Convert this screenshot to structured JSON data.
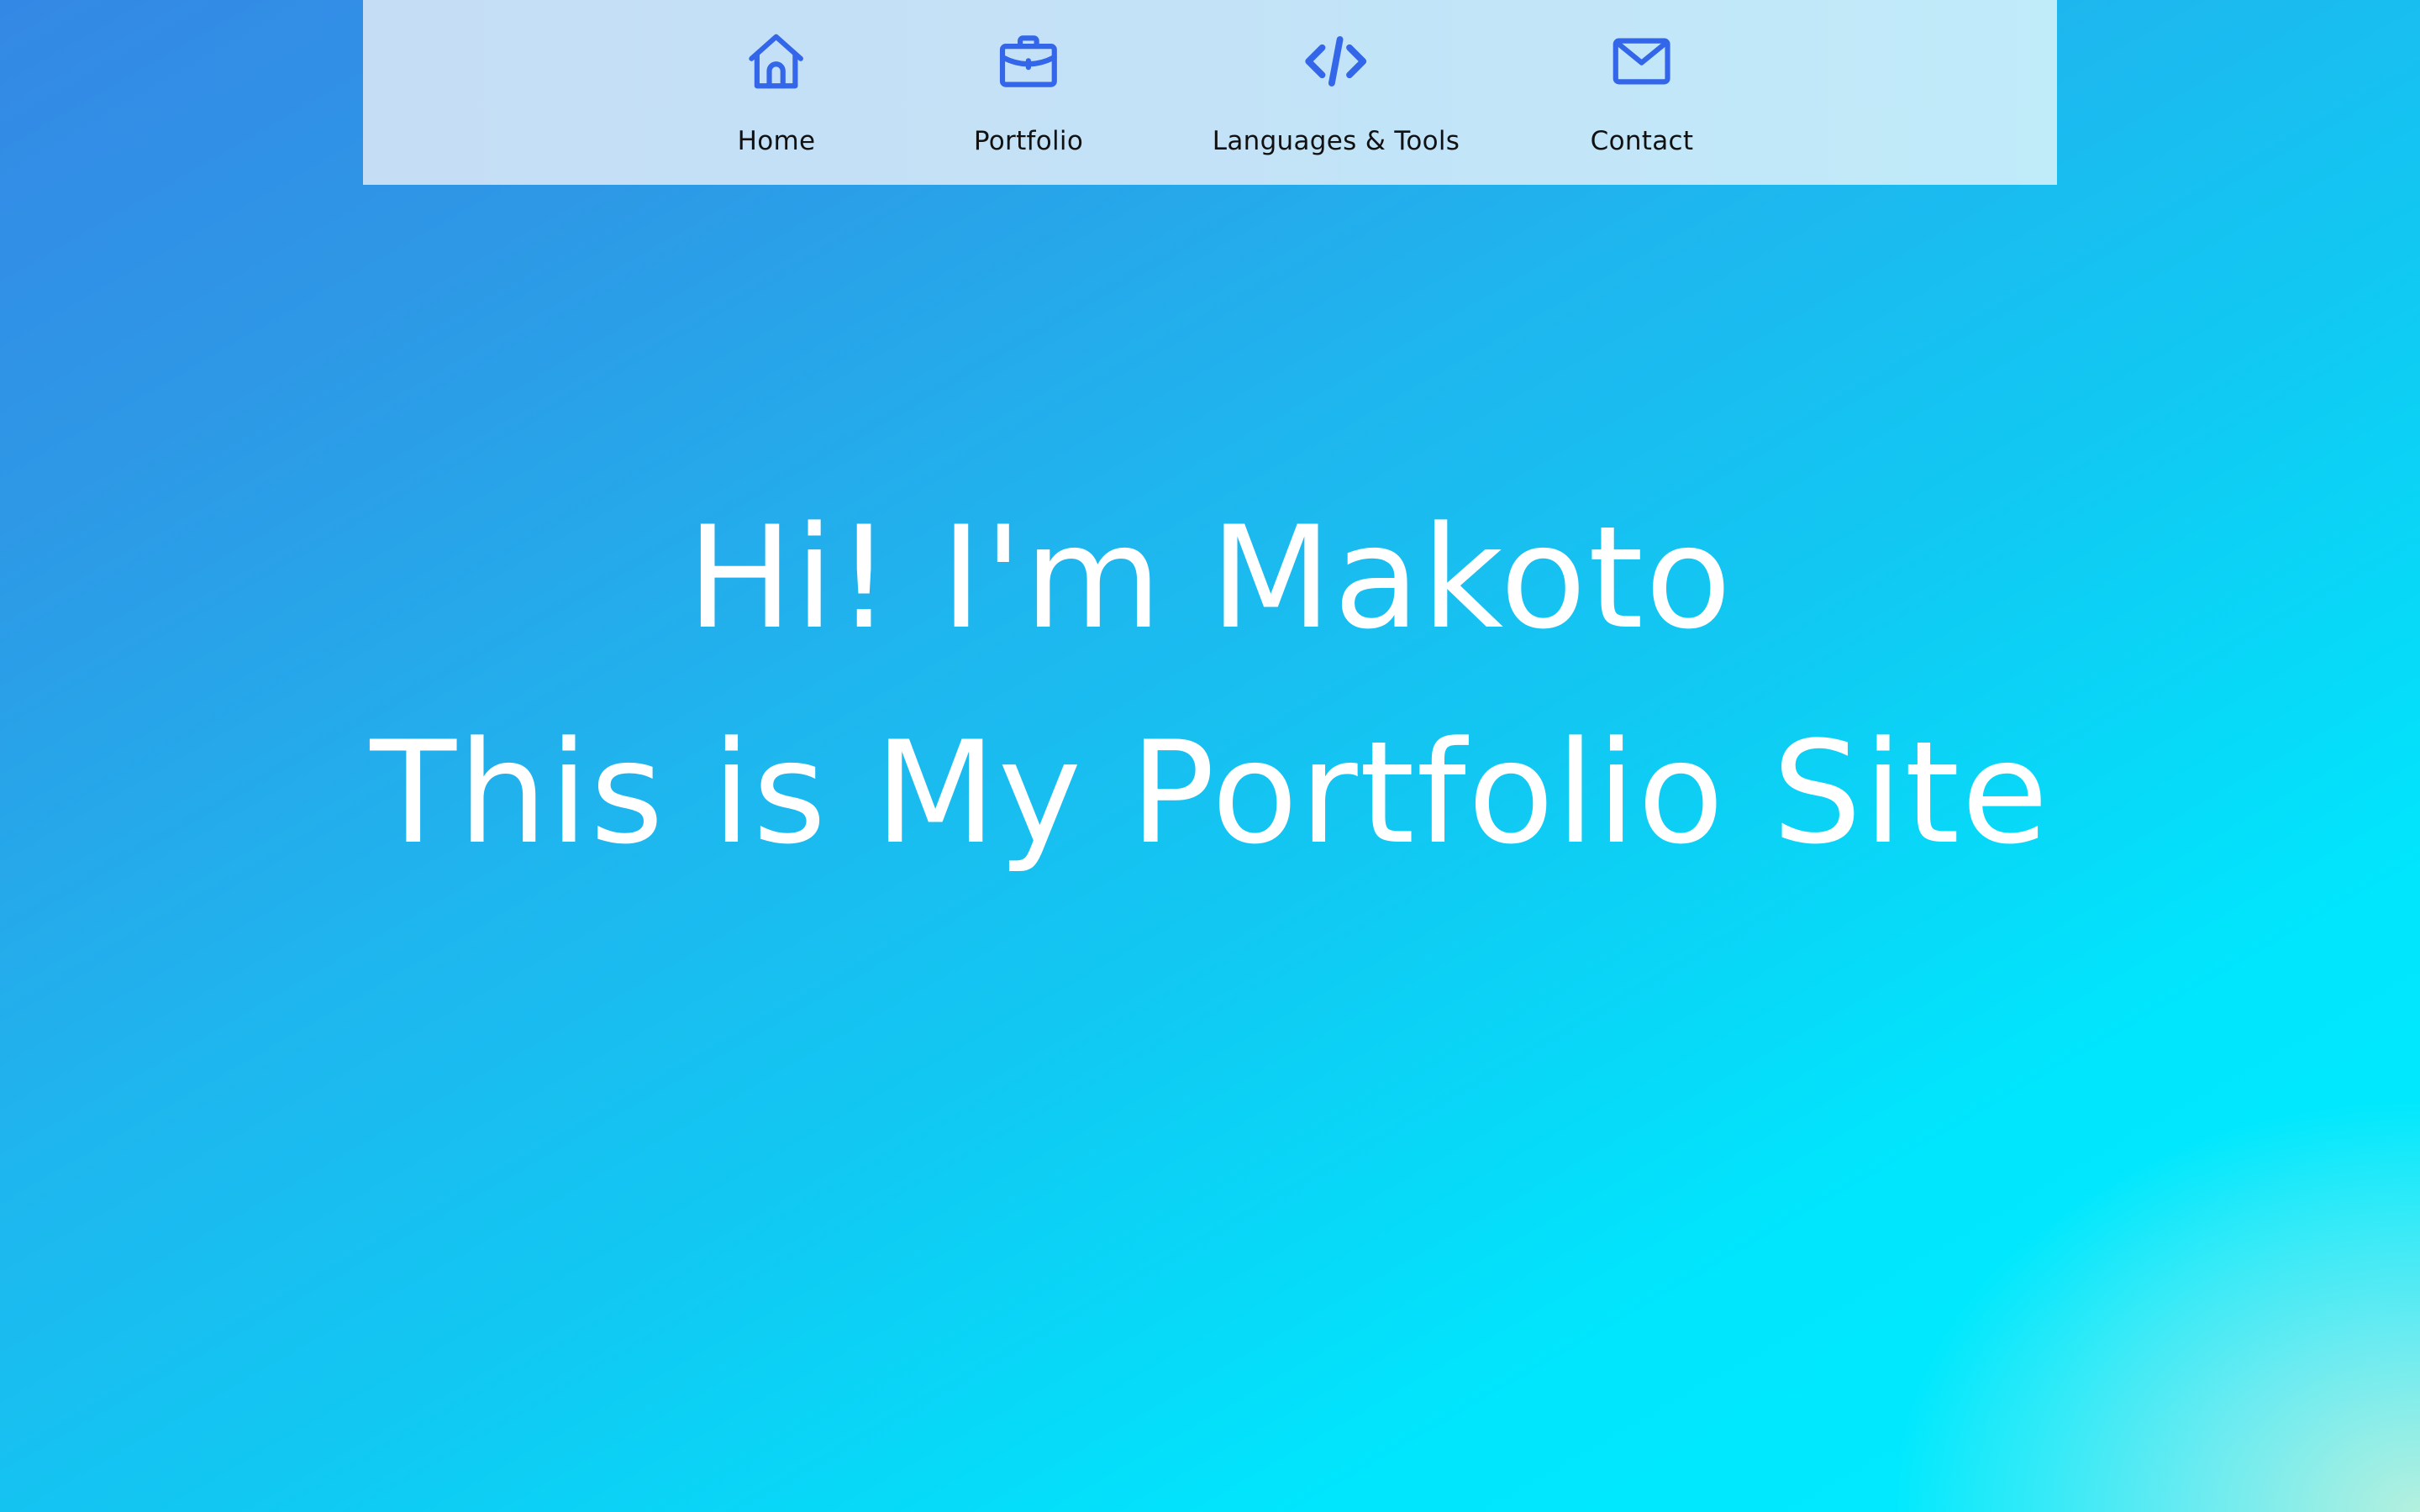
{
  "nav": {
    "items": [
      {
        "label": "Home",
        "icon": "home-icon"
      },
      {
        "label": "Portfolio",
        "icon": "briefcase-icon"
      },
      {
        "label": "Languages & Tools",
        "icon": "code-icon"
      },
      {
        "label": "Contact",
        "icon": "mail-icon"
      }
    ],
    "icon_color": "#3366e8",
    "background": "#c4e2f6"
  },
  "hero": {
    "line1": "Hi! I'm Makoto",
    "line2": "This is My Portfolio Site"
  },
  "colors": {
    "gradient_start": "#3488e5",
    "gradient_mid": "#1fb5ee",
    "gradient_end": "#00ecff",
    "text": "#ffffff"
  }
}
